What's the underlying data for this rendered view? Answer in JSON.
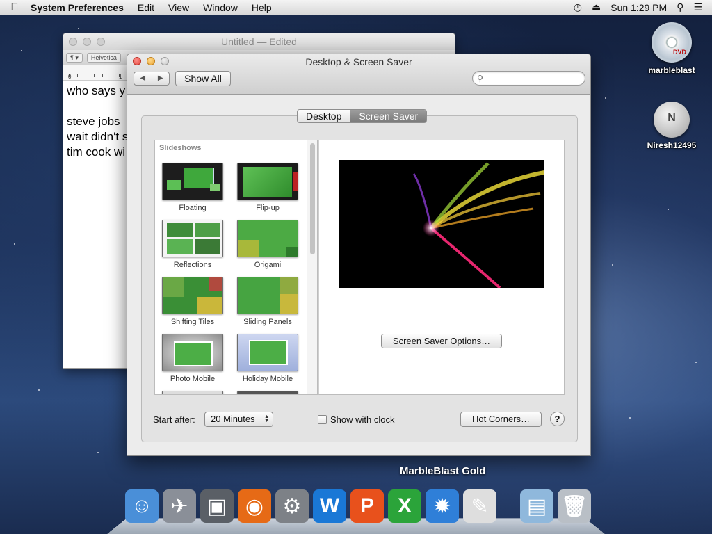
{
  "menubar": {
    "app_name": "System Preferences",
    "items": [
      "Edit",
      "View",
      "Window",
      "Help"
    ],
    "clock": "Sun 1:29 PM"
  },
  "textedit": {
    "title": "Untitled",
    "title_suffix": "— Edited",
    "font_label": "Helvetica",
    "style_label": "¶ ▾",
    "ruler_numbers": [
      "0",
      "1"
    ],
    "lines": [
      "who says y",
      "",
      "steve jobs",
      "wait didn't s",
      "tim cook wi"
    ]
  },
  "prefs": {
    "title": "Desktop & Screen Saver",
    "show_all": "Show All",
    "search_placeholder": "",
    "tabs": [
      "Desktop",
      "Screen Saver"
    ],
    "active_tab": "Screen Saver",
    "list_header": "Slideshows",
    "savers": [
      "Floating",
      "Flip-up",
      "Reflections",
      "Origami",
      "Shifting Tiles",
      "Sliding Panels",
      "Photo Mobile",
      "Holiday Mobile"
    ],
    "options_button": "Screen Saver Options…",
    "start_after_label": "Start after:",
    "start_after_value": "20 Minutes",
    "show_clock_label": "Show with clock",
    "show_clock_checked": false,
    "hot_corners": "Hot Corners…",
    "help": "?"
  },
  "desktop_icons": [
    {
      "label": "marbleblast",
      "icon": "dvd-icon"
    },
    {
      "label": "Niresh12495",
      "icon": "user-disk-icon"
    }
  ],
  "dock": {
    "hover_label": "MarbleBlast Gold",
    "apps": [
      {
        "name": "finder-icon",
        "glyph": "☺",
        "color": "#4a8fd8"
      },
      {
        "name": "launchpad-icon",
        "glyph": "✈",
        "color": "#8a8f98"
      },
      {
        "name": "image-capture-icon",
        "glyph": "▣",
        "color": "#5a5f66"
      },
      {
        "name": "firefox-icon",
        "glyph": "◉",
        "color": "#e66a16"
      },
      {
        "name": "system-preferences-icon",
        "glyph": "⚙",
        "color": "#7d8187"
      },
      {
        "name": "word-icon",
        "glyph": "W",
        "color": "#1a78d6"
      },
      {
        "name": "powerpoint-icon",
        "glyph": "P",
        "color": "#e8511c"
      },
      {
        "name": "excel-icon",
        "glyph": "X",
        "color": "#2ba43a"
      },
      {
        "name": "marbleblast-icon",
        "glyph": "✹",
        "color": "#2f7fd8"
      },
      {
        "name": "textedit-icon",
        "glyph": "✎",
        "color": "#dedede"
      },
      {
        "name": "downloads-folder-icon",
        "glyph": "▤",
        "color": "#8fb8dc"
      },
      {
        "name": "trash-icon",
        "glyph": "🗑",
        "color": "#b9bfc6"
      }
    ]
  },
  "colors": {
    "accent_active_tab": "#8a8a8a",
    "close_button": "#e0443a",
    "minimize_button": "#e9a22f"
  }
}
